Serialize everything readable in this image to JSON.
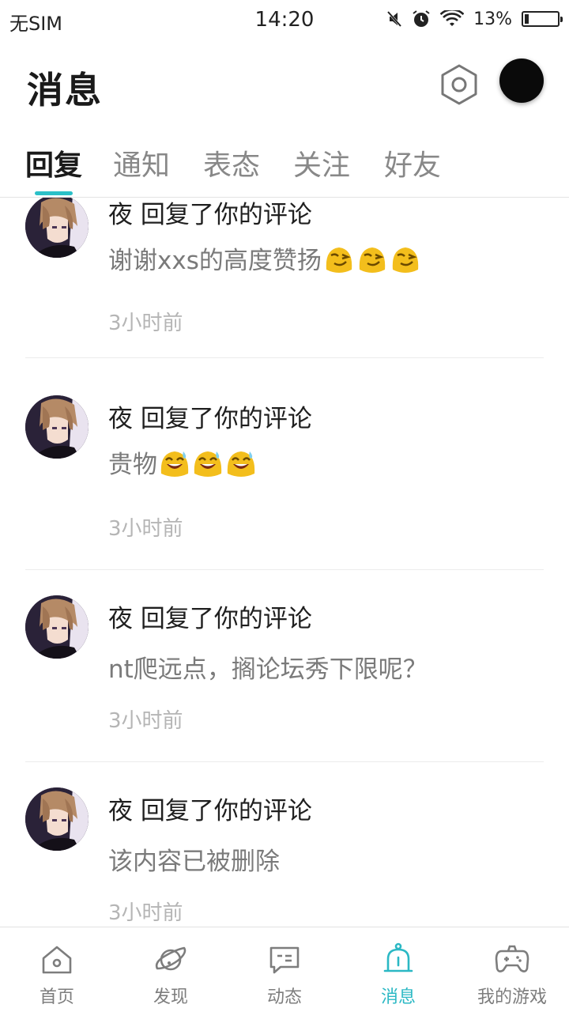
{
  "status_bar": {
    "carrier": "无SIM",
    "time": "14:20",
    "battery_percent": "13%",
    "battery_level": 0.13,
    "icons": [
      "mute-icon",
      "alarm-icon",
      "wifi-icon",
      "battery-icon"
    ]
  },
  "header": {
    "title": "消息",
    "settings_icon": "hexagon-settings-icon",
    "avatar": "user-avatar"
  },
  "tabs": [
    {
      "label": "回复",
      "active": true
    },
    {
      "label": "通知",
      "active": false
    },
    {
      "label": "表态",
      "active": false
    },
    {
      "label": "关注",
      "active": false
    },
    {
      "label": "好友",
      "active": false
    }
  ],
  "accent_color": "#2bc0c8",
  "messages": [
    {
      "user": "夜",
      "action": "回复了你的评论",
      "title": "夜 回复了你的评论",
      "body": "谢谢xxs的高度赞扬",
      "emoji": "wink-emoji",
      "emoji_count": 3,
      "time": "3小时前"
    },
    {
      "user": "夜",
      "action": "回复了你的评论",
      "title": "夜 回复了你的评论",
      "body": "贵物",
      "emoji": "grin-sweat-emoji",
      "emoji_count": 3,
      "time": "3小时前"
    },
    {
      "user": "夜",
      "action": "回复了你的评论",
      "title": "夜 回复了你的评论",
      "body": "nt爬远点，搁论坛秀下限呢？",
      "emoji": "",
      "emoji_count": 0,
      "time": "3小时前"
    },
    {
      "user": "夜",
      "action": "回复了你的评论",
      "title": "夜 回复了你的评论",
      "body": "该内容已被删除",
      "emoji": "",
      "emoji_count": 0,
      "time": "3小时前"
    }
  ],
  "bottom_nav": [
    {
      "label": "首页",
      "icon": "home-icon",
      "active": false
    },
    {
      "label": "发现",
      "icon": "planet-icon",
      "active": false
    },
    {
      "label": "动态",
      "icon": "message-card-icon",
      "active": false
    },
    {
      "label": "消息",
      "icon": "bell-icon",
      "active": true
    },
    {
      "label": "我的游戏",
      "icon": "gamepad-icon",
      "active": false
    }
  ]
}
